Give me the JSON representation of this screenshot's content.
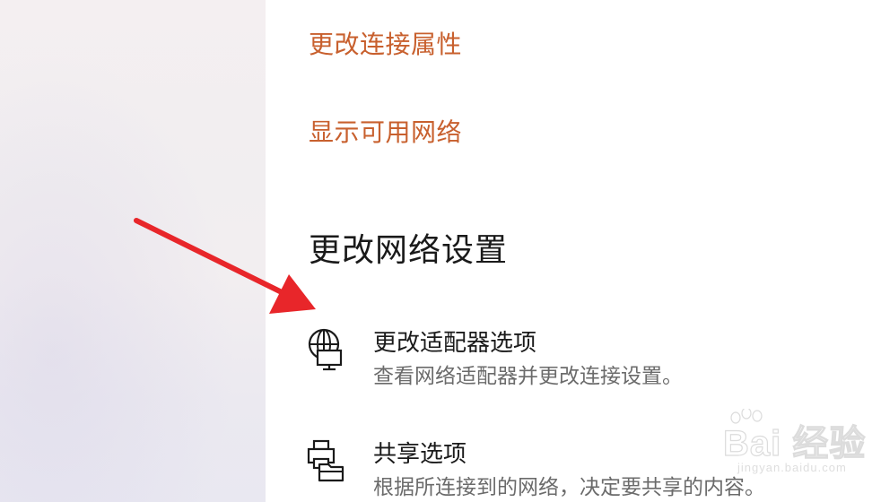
{
  "links": [
    {
      "label": "更改连接属性"
    },
    {
      "label": "显示可用网络"
    }
  ],
  "section": {
    "title": "更改网络设置"
  },
  "options": [
    {
      "title": "更改适配器选项",
      "description": "查看网络适配器并更改连接设置。",
      "icon": "network-adapter-icon"
    },
    {
      "title": "共享选项",
      "description": "根据所连接到的网络，决定要共享的内容。",
      "icon": "sharing-options-icon"
    }
  ],
  "watermark": {
    "brand": "Bai 经验",
    "url": "jingyan.baidu.com"
  },
  "colors": {
    "link": "#c8602e",
    "heading": "#1a1a1a",
    "description": "#6b6b6b",
    "annotation_arrow": "#e8262a"
  }
}
